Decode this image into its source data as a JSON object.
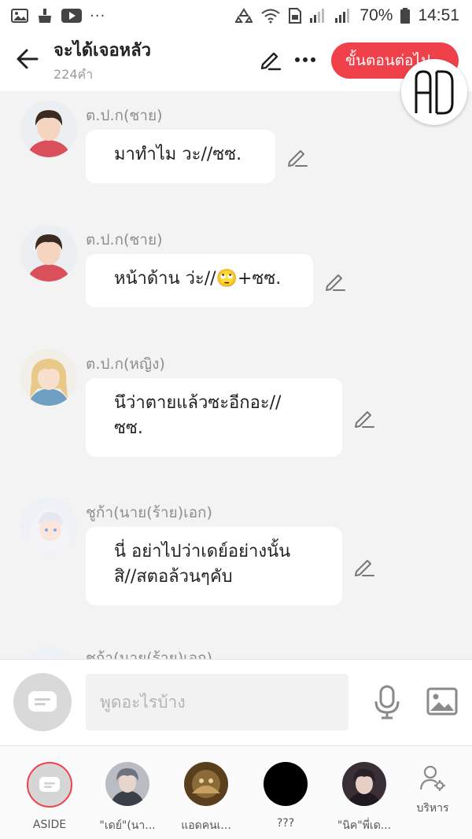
{
  "status_bar": {
    "battery": "70%",
    "time": "14:51",
    "more": "···"
  },
  "header": {
    "title": "จะได้เจอหลัว",
    "subtitle": "224คำ",
    "next_button": "ขั้นตอนต่อไป",
    "badge_text": "AD"
  },
  "messages": [
    {
      "name": "ต.ป.ก(ชาย)",
      "lines": [
        "มาทำไม วะ//ซซ."
      ]
    },
    {
      "name": "ต.ป.ก(ชาย)",
      "lines": [
        "หน้าด้าน ว่ะ//🙄+ซซ."
      ]
    },
    {
      "name": "ต.ป.ก(หญิง)",
      "lines": [
        "นึว่าตายแล้วซะอีกอะ//",
        "ซซ."
      ]
    },
    {
      "name": "ชูก้า(นาย(ร้าย)เอก)",
      "lines": [
        "นี่ อย่าไปว่าเดย์อย่างนั้น",
        "สิ//สตอล้วนๆคับ"
      ]
    },
    {
      "name": "ชูก้า(นาย(ร้าย)เอก)",
      "lines": []
    }
  ],
  "input": {
    "placeholder": "พูดอะไรบ้าง"
  },
  "characters": [
    {
      "label": "ASIDE"
    },
    {
      "label": "\"เดย์\"(นา..."
    },
    {
      "label": "แอดคนเ..."
    },
    {
      "label": "???"
    },
    {
      "label": "\"นิค\"พี่เด..."
    }
  ],
  "manage_label": "บริหาร",
  "colors": {
    "accent": "#f0414a",
    "background": "#f3f3f3",
    "bubble": "#ffffff",
    "name_text": "#8e8e8e"
  }
}
